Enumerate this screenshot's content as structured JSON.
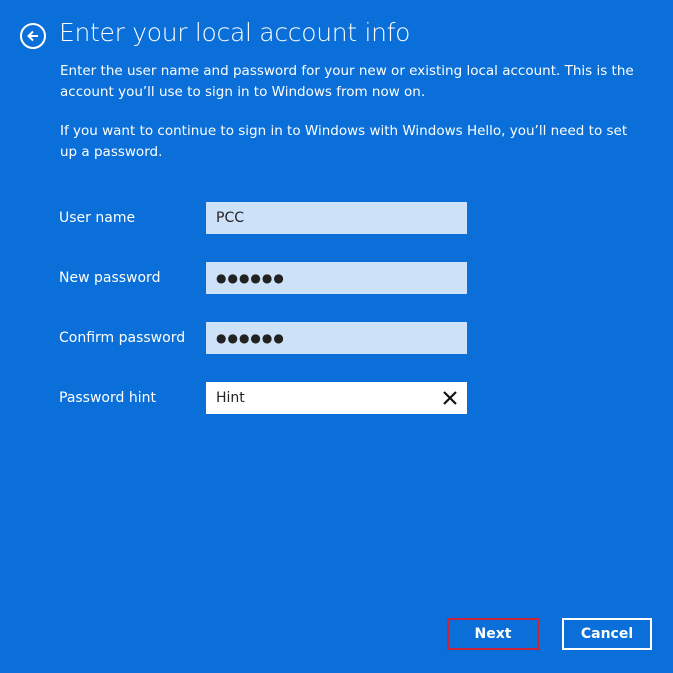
{
  "header": {
    "title": "Enter your local account info",
    "back_icon": "arrow-left-circle-icon"
  },
  "description": [
    "Enter the user name and password for your new or existing local account. This is the account you’ll use to sign in to Windows from now on.",
    "If you want to continue to sign in to Windows with Windows Hello, you’ll need to set up a password."
  ],
  "form": {
    "username": {
      "label": "User name",
      "value": "PCC"
    },
    "new_password": {
      "label": "New password",
      "value": "●●●●●●"
    },
    "confirm_password": {
      "label": "Confirm password",
      "value": "●●●●●●"
    },
    "password_hint": {
      "label": "Password hint",
      "value": "Hint",
      "clear_icon": "close-icon"
    }
  },
  "buttons": {
    "next": "Next",
    "cancel": "Cancel"
  },
  "colors": {
    "background": "#0a6fd8",
    "field": "#cde2f8",
    "highlight": "#c8243c"
  }
}
